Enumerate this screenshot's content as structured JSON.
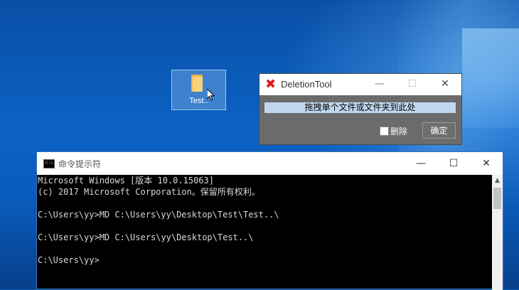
{
  "desktop": {
    "icon_label": "Test.."
  },
  "deletion_tool": {
    "title": "DeletionTool",
    "drop_text": "拖拽单个文件或文件夹到此处",
    "delete_label": "删除",
    "ok_label": "确定",
    "min_glyph": "—",
    "max_glyph": "☐",
    "close_glyph": "✕"
  },
  "cmd": {
    "title": "命令提示符",
    "min_glyph": "—",
    "max_glyph": "☐",
    "close_glyph": "✕",
    "lines": [
      "Microsoft Windows [版本 10.0.15063]",
      "(c) 2017 Microsoft Corporation。保留所有权利。",
      "",
      "C:\\Users\\yy>MD C:\\Users\\yy\\Desktop\\Test\\Test..\\",
      "",
      "C:\\Users\\yy>MD C:\\Users\\yy\\Desktop\\Test..\\",
      "",
      "C:\\Users\\yy>"
    ]
  },
  "colors": {
    "accent_blue": "#0a57b5",
    "close_red": "#d6201a",
    "drop_zone": "#bfd6ee"
  }
}
